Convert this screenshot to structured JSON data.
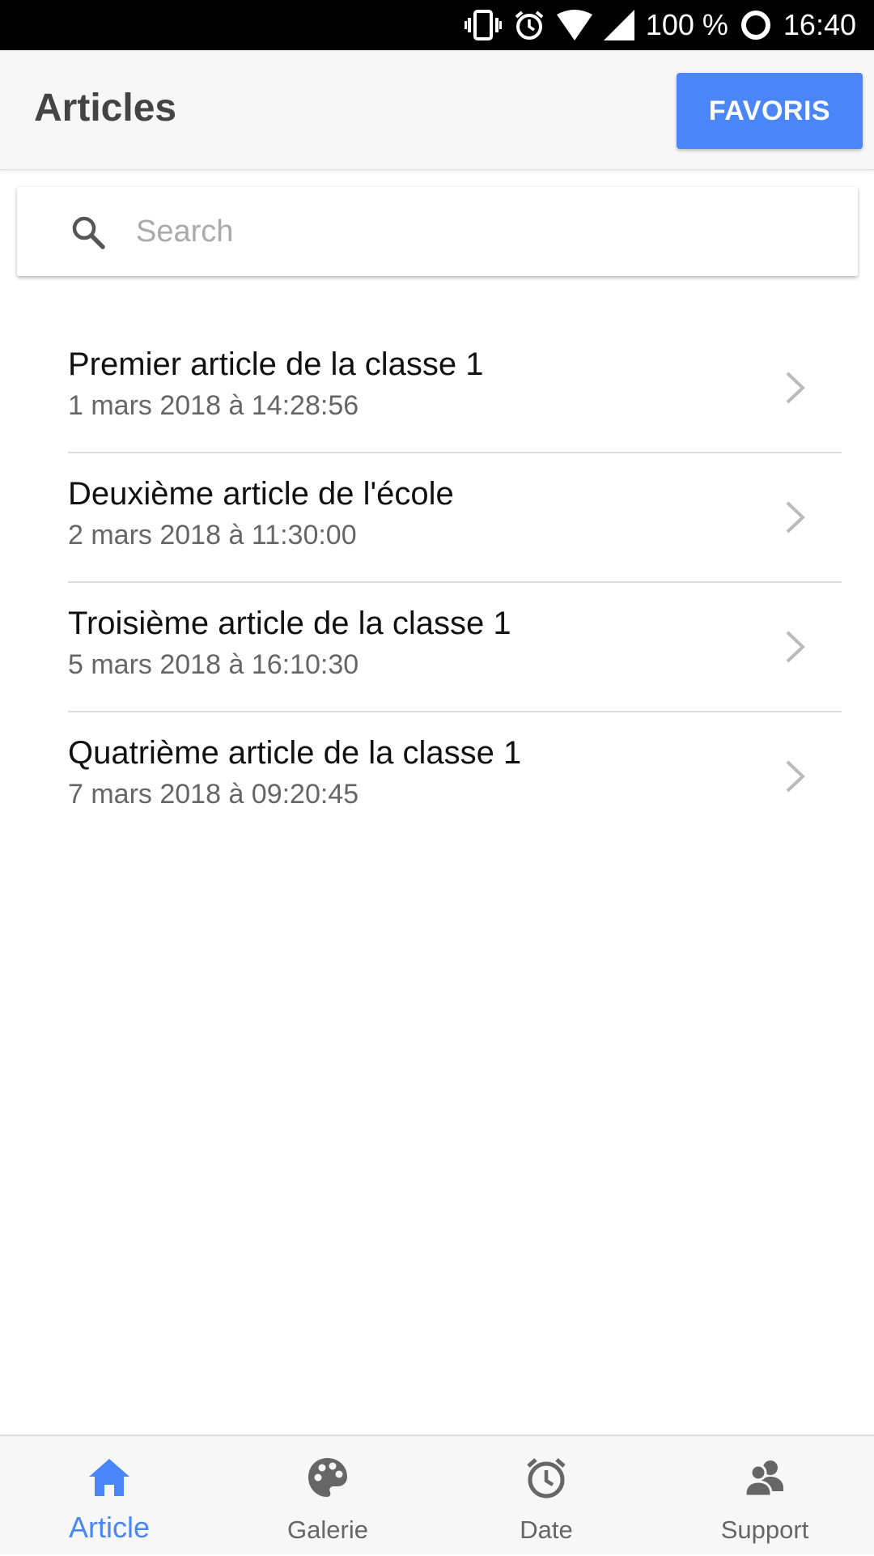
{
  "status_bar": {
    "battery": "100 %",
    "time": "16:40",
    "icons": [
      "vibrate-icon",
      "alarm-icon",
      "wifi-icon",
      "signal-icon",
      "battery-ring-icon"
    ]
  },
  "header": {
    "title": "Articles",
    "favoris_label": "FAVORIS",
    "accent_color": "#4a86f7"
  },
  "search": {
    "placeholder": "Search",
    "value": ""
  },
  "articles": [
    {
      "title": "Premier article de la classe 1",
      "date": "1 mars 2018 à 14:28:56"
    },
    {
      "title": "Deuxième article de l'école",
      "date": "2 mars 2018 à 11:30:00"
    },
    {
      "title": "Troisième article de la classe 1",
      "date": "5 mars 2018 à 16:10:30"
    },
    {
      "title": "Quatrième article de la classe 1",
      "date": "7 mars 2018 à 09:20:45"
    }
  ],
  "bottom_nav": {
    "active": "Article",
    "items": [
      {
        "label": "Article",
        "icon": "home-icon"
      },
      {
        "label": "Galerie",
        "icon": "palette-icon"
      },
      {
        "label": "Date",
        "icon": "alarm-clock-icon"
      },
      {
        "label": "Support",
        "icon": "support-people-icon"
      }
    ]
  }
}
